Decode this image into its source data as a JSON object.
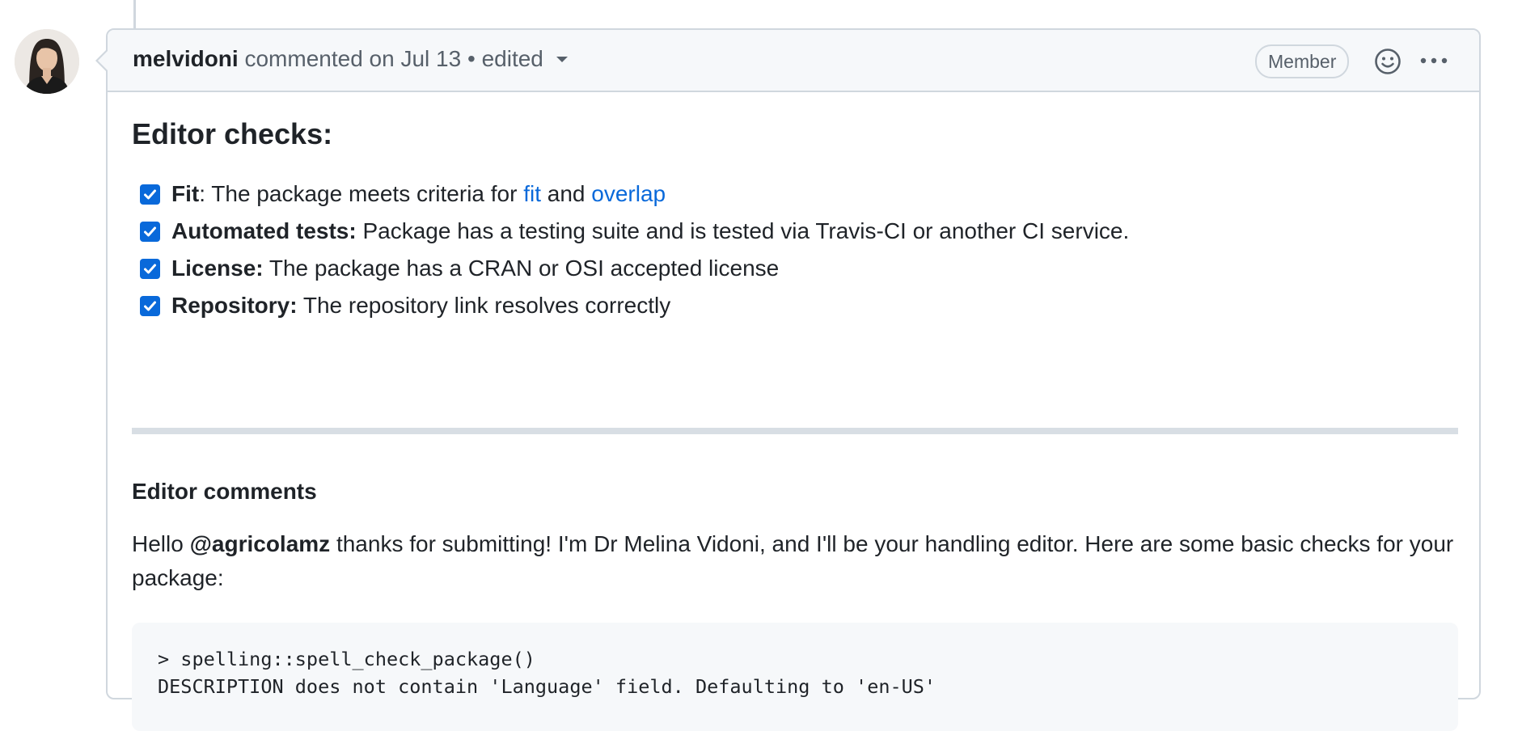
{
  "comment": {
    "author": "melvidoni",
    "action_text": "commented on Jul 13",
    "separator": "•",
    "edited_label": "edited",
    "badge": "Member",
    "icons": {
      "reaction": "smiley-icon",
      "more": "kebab-horizontal-icon",
      "avatar": "user-avatar"
    },
    "colors": {
      "link": "#0969da",
      "checkbox": "#0969da",
      "header_bg": "#f6f8fa",
      "border": "#d0d7de"
    }
  },
  "body": {
    "heading": "Editor checks:",
    "checklist": [
      {
        "checked": true,
        "bold": "Fit",
        "text_a": ": The package meets criteria for ",
        "link1": "fit",
        "text_b": " and ",
        "link2": "overlap"
      },
      {
        "checked": true,
        "bold": "Automated tests:",
        "text": " Package has a testing suite and is tested via Travis-CI or another CI service."
      },
      {
        "checked": true,
        "bold": "License:",
        "text": " The package has a CRAN or OSI accepted license"
      },
      {
        "checked": true,
        "bold": "Repository:",
        "text": " The repository link resolves correctly"
      }
    ],
    "subheading": "Editor comments",
    "para_prefix": "Hello ",
    "mention": "@agricolamz",
    "para_suffix": " thanks for submitting! I'm Dr Melina Vidoni, and I'll be your handling editor. Here are some basic checks for your package:",
    "code": "> spelling::spell_check_package()\nDESCRIPTION does not contain 'Language' field. Defaulting to 'en-US'"
  }
}
